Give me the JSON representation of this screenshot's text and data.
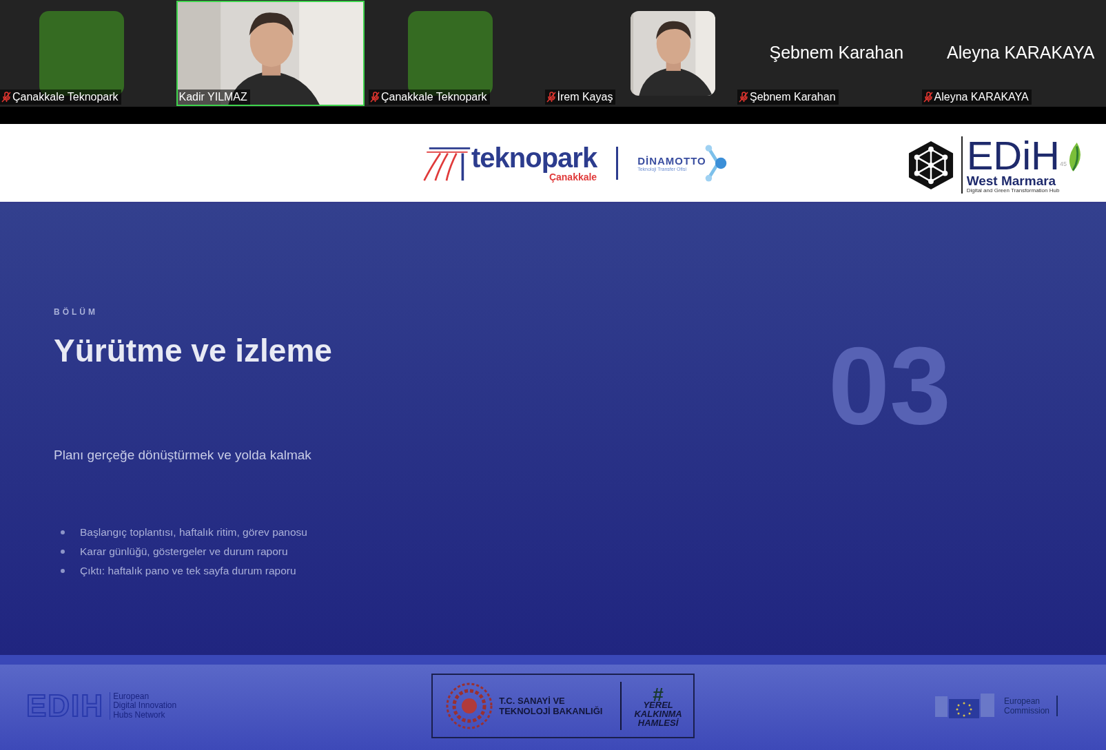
{
  "participants": [
    {
      "kind": "avatar",
      "name": "Çanakkale Teknopark",
      "muted": true,
      "active": false
    },
    {
      "kind": "video",
      "name": "Kadir YILMAZ",
      "muted": false,
      "active": true
    },
    {
      "kind": "avatar",
      "name": "Çanakkale Teknopark",
      "muted": true,
      "active": false
    },
    {
      "kind": "video",
      "name": "İrem Kayaş",
      "muted": true,
      "active": false
    },
    {
      "kind": "name",
      "display_name": "Şebnem Karahan",
      "name": "Şebnem Karahan",
      "muted": true,
      "active": false
    },
    {
      "kind": "name",
      "display_name": "Aleyna KARAKAYA",
      "name": "Aleyna KARAKAYA",
      "muted": true,
      "active": false
    }
  ],
  "slide": {
    "header": {
      "teknopark": {
        "name": "teknopark",
        "city": "Çanakkale"
      },
      "dinamotto": {
        "name": "DİNAMOTTO",
        "subtitle": "Teknoloji Transfer Ofisi"
      },
      "edih": {
        "name": "EDiH",
        "number": "45",
        "region": "West Marmara",
        "tagline": "Digital and Green Transformation Hub"
      }
    },
    "eyebrow": "BÖLÜM",
    "title": "Yürütme ve izleme",
    "number": "03",
    "subtitle": "Planı gerçeğe dönüştürmek ve yolda kalmak",
    "bullets": [
      "Başlangıç toplantısı, haftalık ritim, görev panosu",
      "Karar günlüğü, göstergeler ve durum raporu",
      "Çıktı: haftalık pano ve tek sayfa durum raporu"
    ],
    "footer": {
      "edih_network": {
        "mark": "EDIH",
        "lines": [
          "European",
          "Digital Innovation",
          "Hubs Network"
        ]
      },
      "ministry": {
        "lines": [
          "T.C. SANAYİ VE",
          "TEKNOLOJİ BAKANLIĞI"
        ],
        "hash": "#",
        "campaign": [
          "YEREL",
          "KALKINMA",
          "HAMLESİ"
        ]
      },
      "commission": {
        "lines": [
          "European",
          "Commission"
        ]
      }
    }
  }
}
